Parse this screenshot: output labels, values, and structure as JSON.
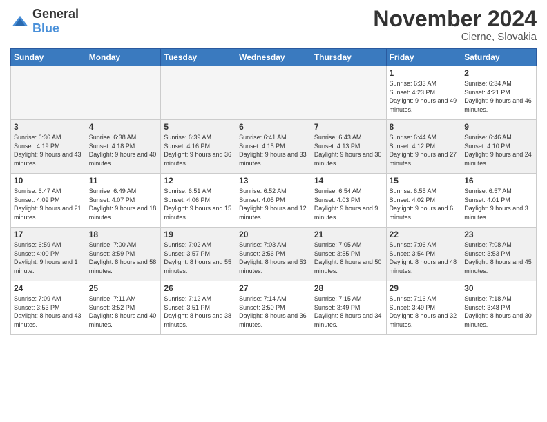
{
  "header": {
    "logo": {
      "general": "General",
      "blue": "Blue"
    },
    "title": "November 2024",
    "location": "Cierne, Slovakia"
  },
  "days_of_week": [
    "Sunday",
    "Monday",
    "Tuesday",
    "Wednesday",
    "Thursday",
    "Friday",
    "Saturday"
  ],
  "weeks": [
    {
      "days": [
        {
          "num": "",
          "info": ""
        },
        {
          "num": "",
          "info": ""
        },
        {
          "num": "",
          "info": ""
        },
        {
          "num": "",
          "info": ""
        },
        {
          "num": "",
          "info": ""
        },
        {
          "num": "1",
          "info": "Sunrise: 6:33 AM\nSunset: 4:23 PM\nDaylight: 9 hours and 49 minutes."
        },
        {
          "num": "2",
          "info": "Sunrise: 6:34 AM\nSunset: 4:21 PM\nDaylight: 9 hours and 46 minutes."
        }
      ]
    },
    {
      "days": [
        {
          "num": "3",
          "info": "Sunrise: 6:36 AM\nSunset: 4:19 PM\nDaylight: 9 hours and 43 minutes."
        },
        {
          "num": "4",
          "info": "Sunrise: 6:38 AM\nSunset: 4:18 PM\nDaylight: 9 hours and 40 minutes."
        },
        {
          "num": "5",
          "info": "Sunrise: 6:39 AM\nSunset: 4:16 PM\nDaylight: 9 hours and 36 minutes."
        },
        {
          "num": "6",
          "info": "Sunrise: 6:41 AM\nSunset: 4:15 PM\nDaylight: 9 hours and 33 minutes."
        },
        {
          "num": "7",
          "info": "Sunrise: 6:43 AM\nSunset: 4:13 PM\nDaylight: 9 hours and 30 minutes."
        },
        {
          "num": "8",
          "info": "Sunrise: 6:44 AM\nSunset: 4:12 PM\nDaylight: 9 hours and 27 minutes."
        },
        {
          "num": "9",
          "info": "Sunrise: 6:46 AM\nSunset: 4:10 PM\nDaylight: 9 hours and 24 minutes."
        }
      ]
    },
    {
      "days": [
        {
          "num": "10",
          "info": "Sunrise: 6:47 AM\nSunset: 4:09 PM\nDaylight: 9 hours and 21 minutes."
        },
        {
          "num": "11",
          "info": "Sunrise: 6:49 AM\nSunset: 4:07 PM\nDaylight: 9 hours and 18 minutes."
        },
        {
          "num": "12",
          "info": "Sunrise: 6:51 AM\nSunset: 4:06 PM\nDaylight: 9 hours and 15 minutes."
        },
        {
          "num": "13",
          "info": "Sunrise: 6:52 AM\nSunset: 4:05 PM\nDaylight: 9 hours and 12 minutes."
        },
        {
          "num": "14",
          "info": "Sunrise: 6:54 AM\nSunset: 4:03 PM\nDaylight: 9 hours and 9 minutes."
        },
        {
          "num": "15",
          "info": "Sunrise: 6:55 AM\nSunset: 4:02 PM\nDaylight: 9 hours and 6 minutes."
        },
        {
          "num": "16",
          "info": "Sunrise: 6:57 AM\nSunset: 4:01 PM\nDaylight: 9 hours and 3 minutes."
        }
      ]
    },
    {
      "days": [
        {
          "num": "17",
          "info": "Sunrise: 6:59 AM\nSunset: 4:00 PM\nDaylight: 9 hours and 1 minute."
        },
        {
          "num": "18",
          "info": "Sunrise: 7:00 AM\nSunset: 3:59 PM\nDaylight: 8 hours and 58 minutes."
        },
        {
          "num": "19",
          "info": "Sunrise: 7:02 AM\nSunset: 3:57 PM\nDaylight: 8 hours and 55 minutes."
        },
        {
          "num": "20",
          "info": "Sunrise: 7:03 AM\nSunset: 3:56 PM\nDaylight: 8 hours and 53 minutes."
        },
        {
          "num": "21",
          "info": "Sunrise: 7:05 AM\nSunset: 3:55 PM\nDaylight: 8 hours and 50 minutes."
        },
        {
          "num": "22",
          "info": "Sunrise: 7:06 AM\nSunset: 3:54 PM\nDaylight: 8 hours and 48 minutes."
        },
        {
          "num": "23",
          "info": "Sunrise: 7:08 AM\nSunset: 3:53 PM\nDaylight: 8 hours and 45 minutes."
        }
      ]
    },
    {
      "days": [
        {
          "num": "24",
          "info": "Sunrise: 7:09 AM\nSunset: 3:53 PM\nDaylight: 8 hours and 43 minutes."
        },
        {
          "num": "25",
          "info": "Sunrise: 7:11 AM\nSunset: 3:52 PM\nDaylight: 8 hours and 40 minutes."
        },
        {
          "num": "26",
          "info": "Sunrise: 7:12 AM\nSunset: 3:51 PM\nDaylight: 8 hours and 38 minutes."
        },
        {
          "num": "27",
          "info": "Sunrise: 7:14 AM\nSunset: 3:50 PM\nDaylight: 8 hours and 36 minutes."
        },
        {
          "num": "28",
          "info": "Sunrise: 7:15 AM\nSunset: 3:49 PM\nDaylight: 8 hours and 34 minutes."
        },
        {
          "num": "29",
          "info": "Sunrise: 7:16 AM\nSunset: 3:49 PM\nDaylight: 8 hours and 32 minutes."
        },
        {
          "num": "30",
          "info": "Sunrise: 7:18 AM\nSunset: 3:48 PM\nDaylight: 8 hours and 30 minutes."
        }
      ]
    }
  ]
}
